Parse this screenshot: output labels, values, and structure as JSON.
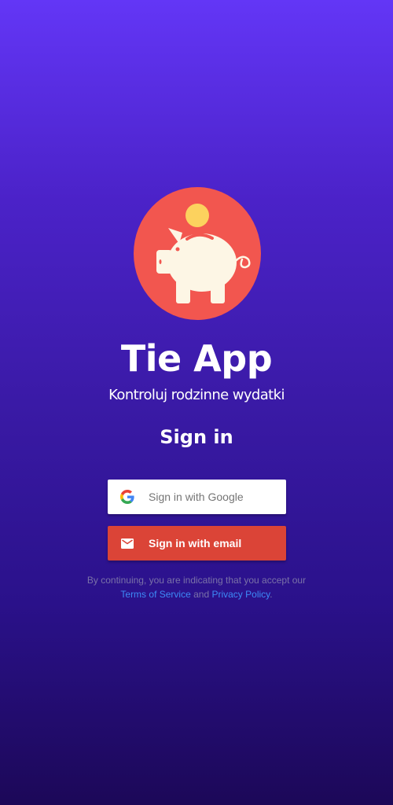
{
  "app": {
    "title": "Tie App",
    "subtitle": "Kontroluj rodzinne wydatki",
    "logo_icon": "piggy-bank-icon",
    "logo_bg_color": "#f2564f",
    "coin_color": "#fcd25e",
    "pig_color": "#fdf6e5"
  },
  "auth": {
    "heading": "Sign in",
    "google_button": {
      "label": "Sign in with Google",
      "icon": "google-logo-icon",
      "bg_color": "#ffffff",
      "text_color": "#757575"
    },
    "email_button": {
      "label": "Sign in with email",
      "icon": "mail-icon",
      "bg_color": "#db4437",
      "text_color": "#ffffff"
    }
  },
  "legal": {
    "line1": "By continuing, you are indicating that you accept our",
    "terms_link": "Terms of Service",
    "and": "and",
    "privacy_link": "Privacy Policy",
    "period": ".",
    "link_color": "#3d8af7"
  },
  "theme": {
    "gradient_top": "#6336f6",
    "gradient_bottom": "#1c0858"
  }
}
